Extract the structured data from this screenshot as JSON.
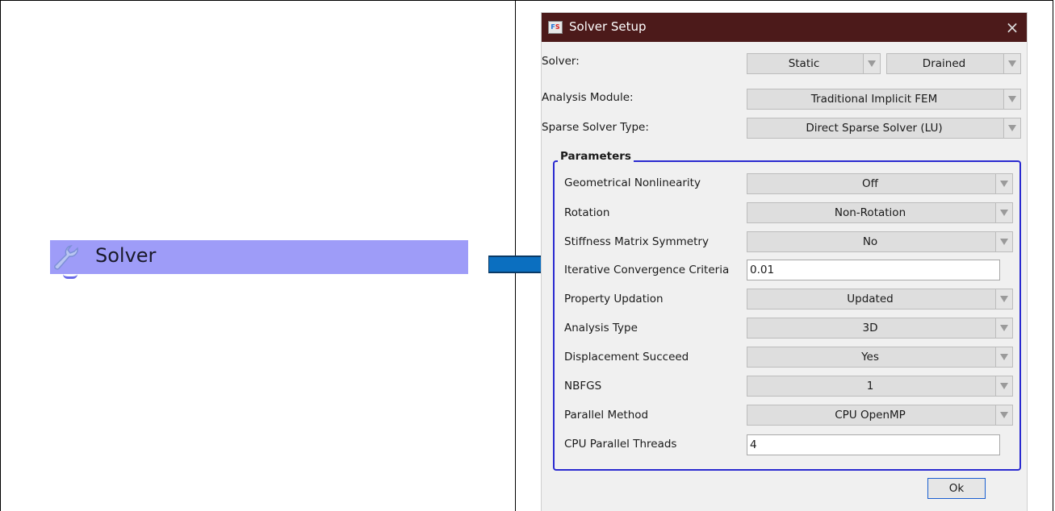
{
  "left_panel": {
    "node_label": "Solver",
    "node_icon": "wrench-icon"
  },
  "dialog": {
    "title": "Solver Setup",
    "close_glyph": "×",
    "rows": {
      "solver": {
        "label": "Solver:",
        "value1": "Static",
        "value2": "Drained"
      },
      "analysis_module": {
        "label": "Analysis Module:",
        "value": "Traditional Implicit FEM"
      },
      "sparse_solver_type": {
        "label": "Sparse Solver Type:",
        "value": "Direct Sparse Solver (LU)"
      }
    },
    "parameters": {
      "title": "Parameters",
      "geometrical_nonlinearity": {
        "label": "Geometrical Nonlinearity",
        "value": "Off"
      },
      "rotation": {
        "label": "Rotation",
        "value": "Non-Rotation"
      },
      "stiffness_matrix_symmetry": {
        "label": "Stiffness Matrix Symmetry",
        "value": "No"
      },
      "convergence": {
        "label": "Iterative Convergence Criteria",
        "value": "0.01"
      },
      "property_updation": {
        "label": "Property Updation",
        "value": "Updated"
      },
      "analysis_type": {
        "label": "Analysis Type",
        "value": "3D"
      },
      "displacement_succeed": {
        "label": "Displacement Succeed",
        "value": "Yes"
      },
      "nbfgs": {
        "label": "NBFGS",
        "value": "1"
      },
      "parallel_method": {
        "label": "Parallel Method",
        "value": "CPU OpenMP"
      },
      "cpu_threads": {
        "label": "CPU Parallel Threads",
        "value": "4"
      }
    },
    "ok_label": "Ok"
  },
  "colors": {
    "titlebar": "#4c1a1a",
    "group_border": "#2a2ad0",
    "tree_highlight": "#9e9cf8",
    "arrow_fill": "#0b6fc0"
  }
}
